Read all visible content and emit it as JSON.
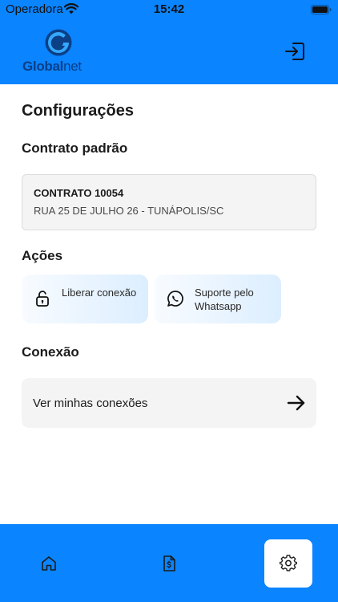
{
  "status_bar": {
    "carrier": "Operadora",
    "time": "15:42",
    "icons": [
      "wifi-icon",
      "battery-icon"
    ]
  },
  "header": {
    "logo": {
      "bold": "Global",
      "light": "net"
    },
    "logout_icon": "logout-icon",
    "background_color": "#0a84ff"
  },
  "page": {
    "title": "Configurações"
  },
  "contract": {
    "section_title": "Contrato padrão",
    "number": "CONTRATO 10054",
    "address": "RUA 25 DE JULHO 26 - TUNÁPOLIS/SC"
  },
  "actions": {
    "section_title": "Ações",
    "items": [
      {
        "label": "Liberar conexão",
        "icon": "unlock-icon"
      },
      {
        "label": "Suporte pelo Whatsapp",
        "icon": "whatsapp-icon"
      }
    ]
  },
  "connection": {
    "section_title": "Conexão",
    "link_label": "Ver minhas conexões",
    "icon": "arrow-right-icon"
  },
  "tabbar": {
    "tabs": [
      {
        "icon": "home-icon",
        "selected": false
      },
      {
        "icon": "invoice-icon",
        "selected": false
      },
      {
        "icon": "gear-icon",
        "selected": true
      }
    ],
    "accent_color": "#0a84ff"
  }
}
